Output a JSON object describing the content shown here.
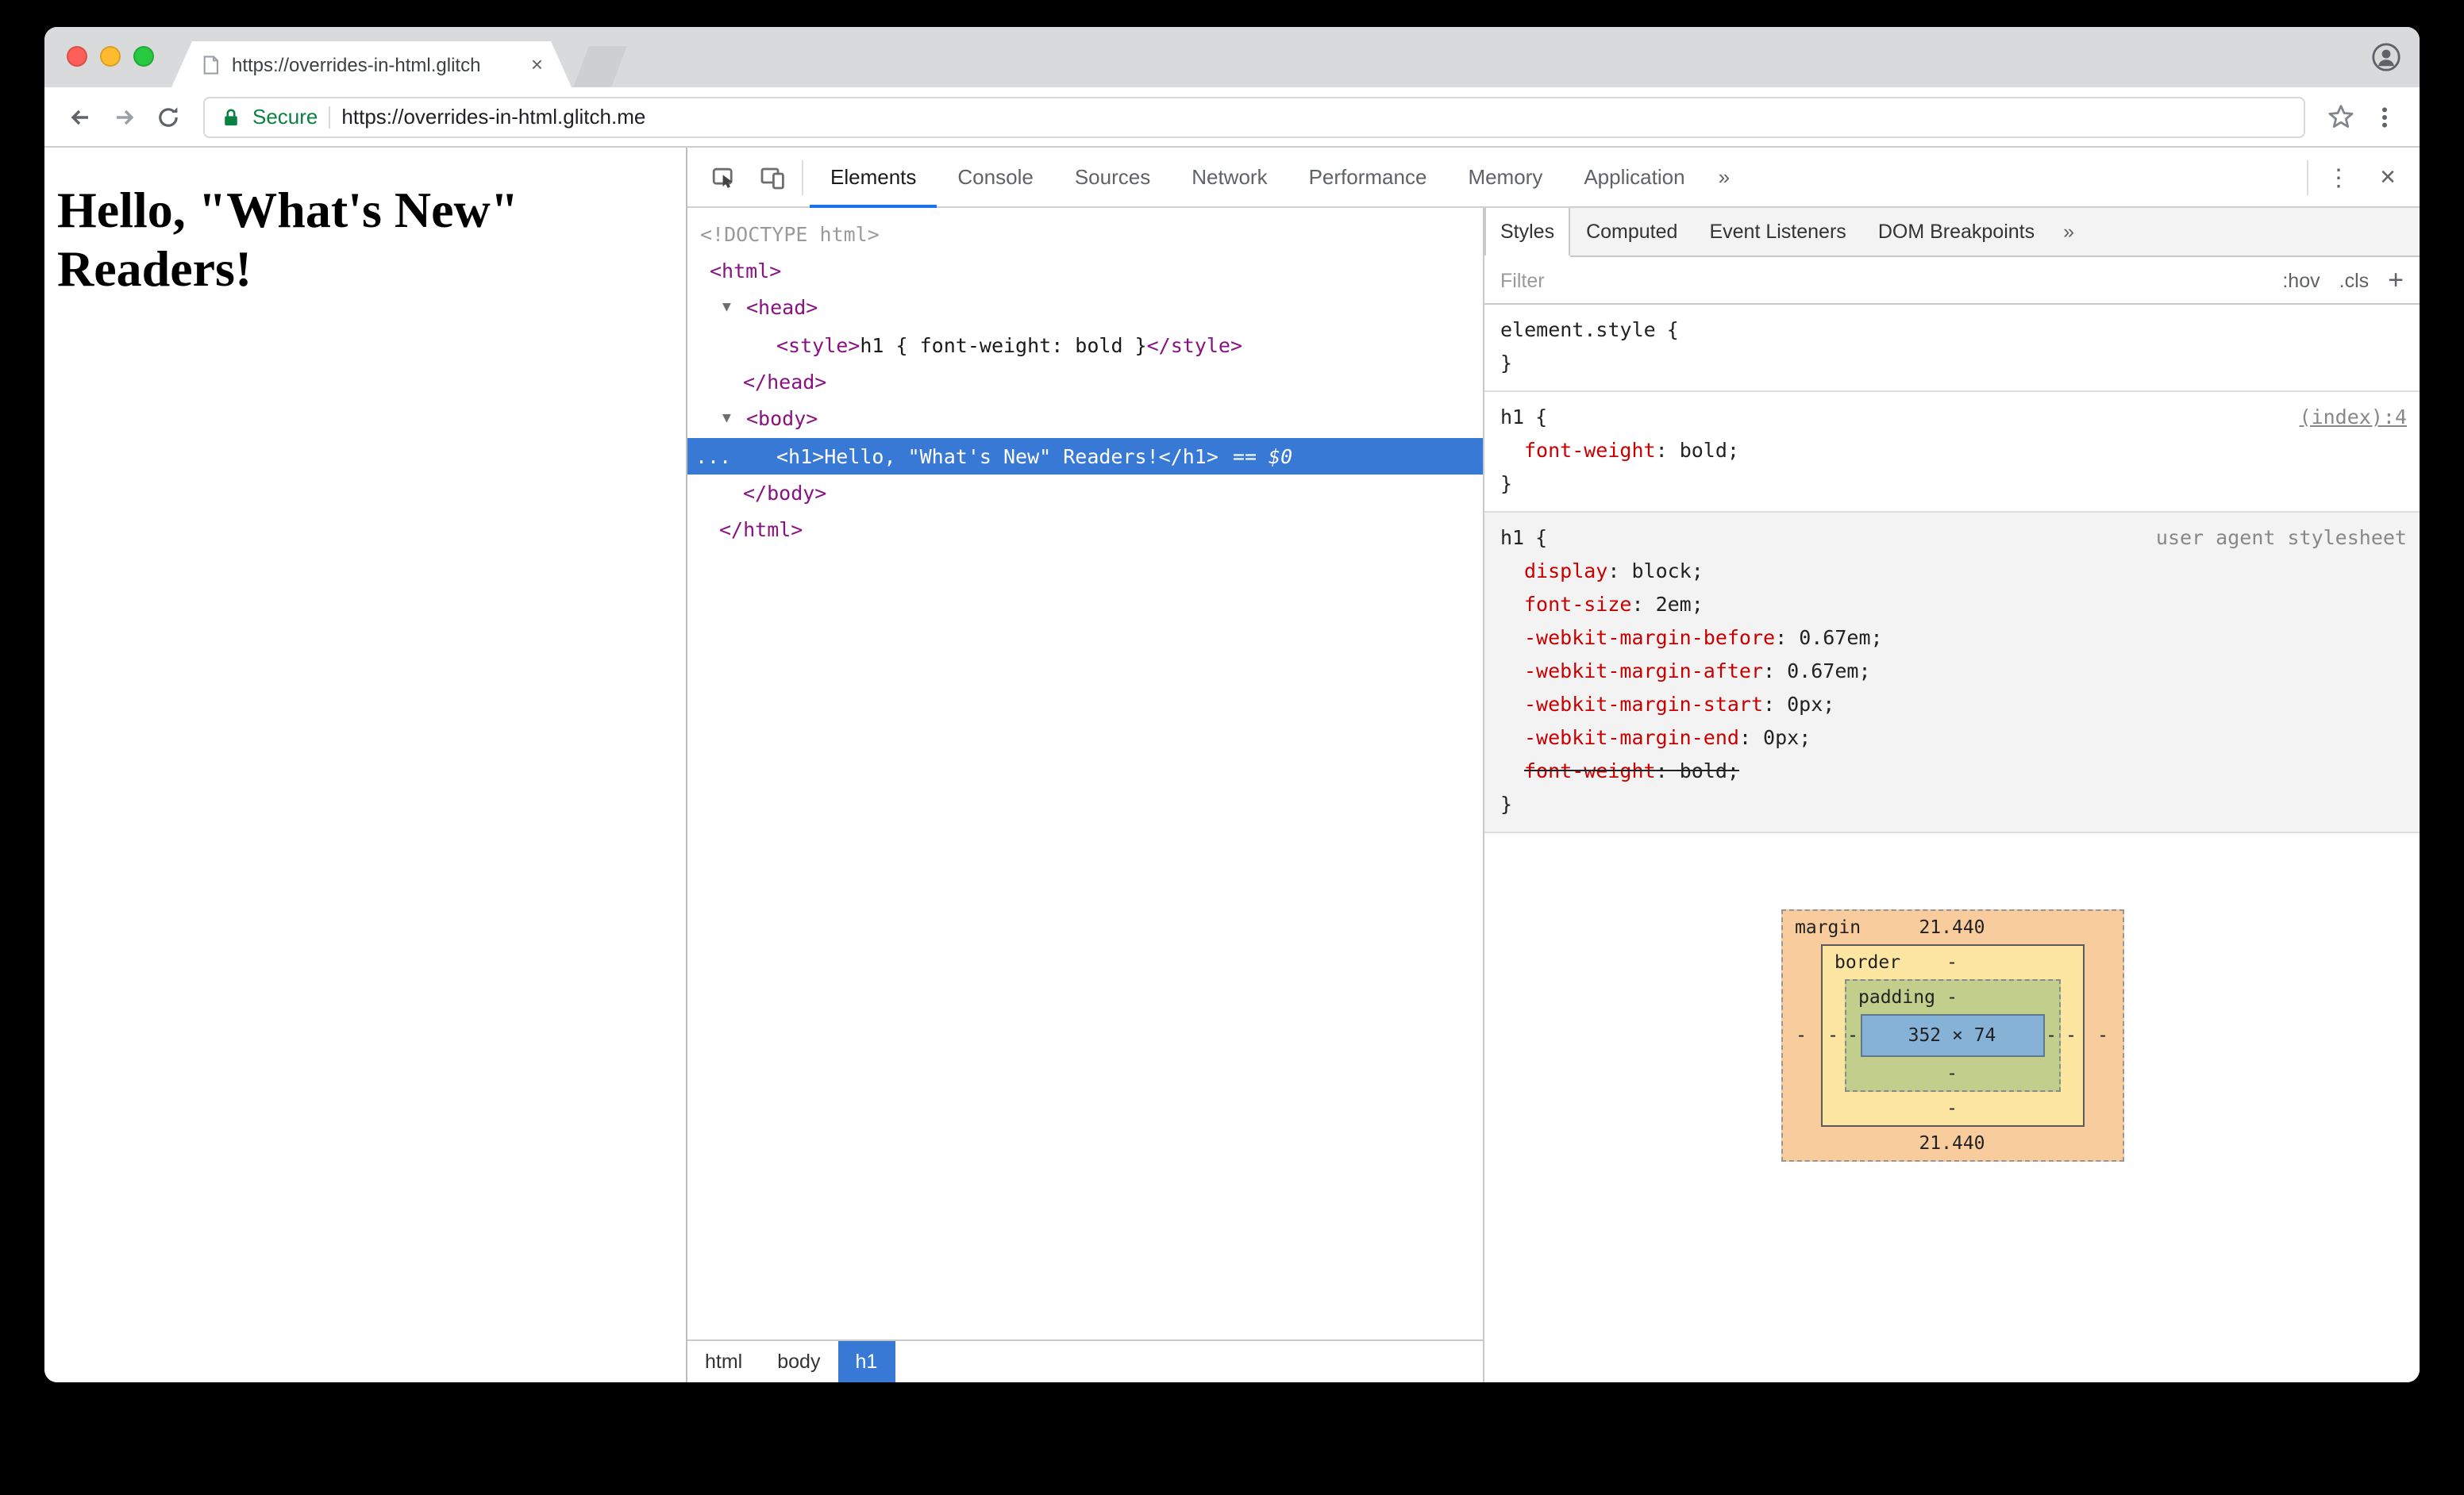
{
  "browser": {
    "tab_title": "https://overrides-in-html.glitch",
    "tab_close": "×",
    "back": "←",
    "forward": "→",
    "secure_label": "Secure",
    "url": "https://overrides-in-html.glitch.me"
  },
  "page": {
    "heading": "Hello, \"What's New\" Readers!"
  },
  "devtools": {
    "tabs": [
      "Elements",
      "Console",
      "Sources",
      "Network",
      "Performance",
      "Memory",
      "Application"
    ],
    "more_tabs": "»",
    "kebab": "⋮",
    "close": "×",
    "tree": {
      "triangle": "▼",
      "doctype": "<!DOCTYPE html>",
      "html_open": "<html>",
      "head_open": "<head>",
      "style_line": {
        "open": "<style>",
        "css": "h1 { font-weight: bold }",
        "close": "</style>"
      },
      "head_close": "</head>",
      "body_open": "<body>",
      "h1_row": {
        "ellipsis": "...",
        "code": "<h1>Hello, \"What's New\" Readers!</h1>",
        "suffix": "== $0"
      },
      "body_close": "</body>",
      "html_close": "</html>"
    },
    "crumbs": [
      "html",
      "body",
      "h1"
    ],
    "sidebar": {
      "tabs": [
        "Styles",
        "Computed",
        "Event Listeners",
        "DOM Breakpoints"
      ],
      "more": "»",
      "filter": {
        "label": "Filter",
        "hov": ":hov",
        "cls": ".cls",
        "plus": "+"
      },
      "element_style": {
        "selector": "element.style",
        "open": "{",
        "close": "}"
      },
      "inline_rule": {
        "selector": "h1",
        "open": "{",
        "close": "}",
        "link": "(index):4",
        "props": [
          {
            "name": "font-weight",
            "rest": ": bold;"
          }
        ]
      },
      "ua_rule": {
        "selector": "h1",
        "open": "{",
        "close": "}",
        "origin": "user agent stylesheet",
        "props": [
          {
            "name": "display",
            "rest": ": block;"
          },
          {
            "name": "font-size",
            "rest": ": 2em;"
          },
          {
            "name": "-webkit-margin-before",
            "rest": ": 0.67em;"
          },
          {
            "name": "-webkit-margin-after",
            "rest": ": 0.67em;"
          },
          {
            "name": "-webkit-margin-start",
            "rest": ": 0px;"
          },
          {
            "name": "-webkit-margin-end",
            "rest": ": 0px;"
          },
          {
            "name": "font-weight",
            "rest": ": bold;"
          }
        ]
      },
      "box_model": {
        "margin_label": "margin",
        "border_label": "border",
        "padding_label": "padding",
        "margin_top": "21.440",
        "margin_bottom": "21.440",
        "dash": "-",
        "content": "352 × 74"
      }
    }
  }
}
